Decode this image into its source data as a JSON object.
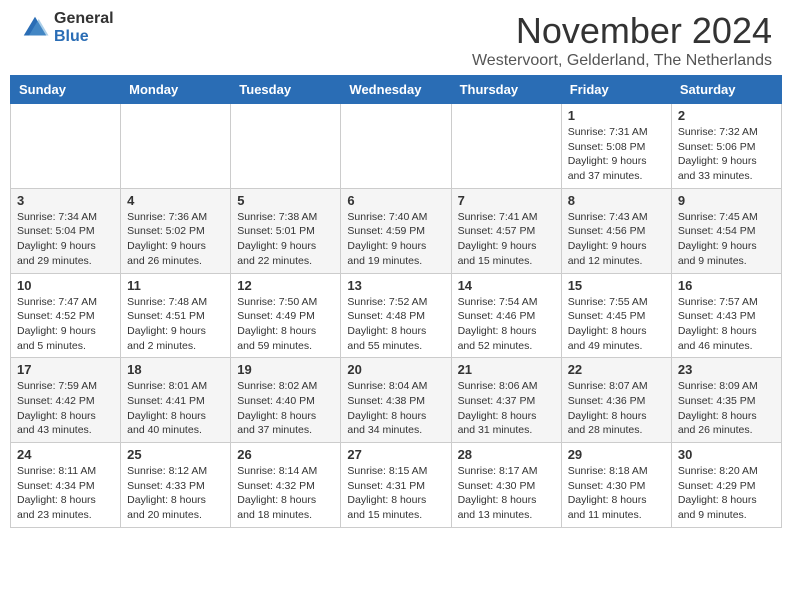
{
  "header": {
    "logo_general": "General",
    "logo_blue": "Blue",
    "month_title": "November 2024",
    "location": "Westervoort, Gelderland, The Netherlands"
  },
  "weekdays": [
    "Sunday",
    "Monday",
    "Tuesday",
    "Wednesday",
    "Thursday",
    "Friday",
    "Saturday"
  ],
  "weeks": [
    [
      {
        "day": "",
        "info": ""
      },
      {
        "day": "",
        "info": ""
      },
      {
        "day": "",
        "info": ""
      },
      {
        "day": "",
        "info": ""
      },
      {
        "day": "",
        "info": ""
      },
      {
        "day": "1",
        "info": "Sunrise: 7:31 AM\nSunset: 5:08 PM\nDaylight: 9 hours and 37 minutes."
      },
      {
        "day": "2",
        "info": "Sunrise: 7:32 AM\nSunset: 5:06 PM\nDaylight: 9 hours and 33 minutes."
      }
    ],
    [
      {
        "day": "3",
        "info": "Sunrise: 7:34 AM\nSunset: 5:04 PM\nDaylight: 9 hours and 29 minutes."
      },
      {
        "day": "4",
        "info": "Sunrise: 7:36 AM\nSunset: 5:02 PM\nDaylight: 9 hours and 26 minutes."
      },
      {
        "day": "5",
        "info": "Sunrise: 7:38 AM\nSunset: 5:01 PM\nDaylight: 9 hours and 22 minutes."
      },
      {
        "day": "6",
        "info": "Sunrise: 7:40 AM\nSunset: 4:59 PM\nDaylight: 9 hours and 19 minutes."
      },
      {
        "day": "7",
        "info": "Sunrise: 7:41 AM\nSunset: 4:57 PM\nDaylight: 9 hours and 15 minutes."
      },
      {
        "day": "8",
        "info": "Sunrise: 7:43 AM\nSunset: 4:56 PM\nDaylight: 9 hours and 12 minutes."
      },
      {
        "day": "9",
        "info": "Sunrise: 7:45 AM\nSunset: 4:54 PM\nDaylight: 9 hours and 9 minutes."
      }
    ],
    [
      {
        "day": "10",
        "info": "Sunrise: 7:47 AM\nSunset: 4:52 PM\nDaylight: 9 hours and 5 minutes."
      },
      {
        "day": "11",
        "info": "Sunrise: 7:48 AM\nSunset: 4:51 PM\nDaylight: 9 hours and 2 minutes."
      },
      {
        "day": "12",
        "info": "Sunrise: 7:50 AM\nSunset: 4:49 PM\nDaylight: 8 hours and 59 minutes."
      },
      {
        "day": "13",
        "info": "Sunrise: 7:52 AM\nSunset: 4:48 PM\nDaylight: 8 hours and 55 minutes."
      },
      {
        "day": "14",
        "info": "Sunrise: 7:54 AM\nSunset: 4:46 PM\nDaylight: 8 hours and 52 minutes."
      },
      {
        "day": "15",
        "info": "Sunrise: 7:55 AM\nSunset: 4:45 PM\nDaylight: 8 hours and 49 minutes."
      },
      {
        "day": "16",
        "info": "Sunrise: 7:57 AM\nSunset: 4:43 PM\nDaylight: 8 hours and 46 minutes."
      }
    ],
    [
      {
        "day": "17",
        "info": "Sunrise: 7:59 AM\nSunset: 4:42 PM\nDaylight: 8 hours and 43 minutes."
      },
      {
        "day": "18",
        "info": "Sunrise: 8:01 AM\nSunset: 4:41 PM\nDaylight: 8 hours and 40 minutes."
      },
      {
        "day": "19",
        "info": "Sunrise: 8:02 AM\nSunset: 4:40 PM\nDaylight: 8 hours and 37 minutes."
      },
      {
        "day": "20",
        "info": "Sunrise: 8:04 AM\nSunset: 4:38 PM\nDaylight: 8 hours and 34 minutes."
      },
      {
        "day": "21",
        "info": "Sunrise: 8:06 AM\nSunset: 4:37 PM\nDaylight: 8 hours and 31 minutes."
      },
      {
        "day": "22",
        "info": "Sunrise: 8:07 AM\nSunset: 4:36 PM\nDaylight: 8 hours and 28 minutes."
      },
      {
        "day": "23",
        "info": "Sunrise: 8:09 AM\nSunset: 4:35 PM\nDaylight: 8 hours and 26 minutes."
      }
    ],
    [
      {
        "day": "24",
        "info": "Sunrise: 8:11 AM\nSunset: 4:34 PM\nDaylight: 8 hours and 23 minutes."
      },
      {
        "day": "25",
        "info": "Sunrise: 8:12 AM\nSunset: 4:33 PM\nDaylight: 8 hours and 20 minutes."
      },
      {
        "day": "26",
        "info": "Sunrise: 8:14 AM\nSunset: 4:32 PM\nDaylight: 8 hours and 18 minutes."
      },
      {
        "day": "27",
        "info": "Sunrise: 8:15 AM\nSunset: 4:31 PM\nDaylight: 8 hours and 15 minutes."
      },
      {
        "day": "28",
        "info": "Sunrise: 8:17 AM\nSunset: 4:30 PM\nDaylight: 8 hours and 13 minutes."
      },
      {
        "day": "29",
        "info": "Sunrise: 8:18 AM\nSunset: 4:30 PM\nDaylight: 8 hours and 11 minutes."
      },
      {
        "day": "30",
        "info": "Sunrise: 8:20 AM\nSunset: 4:29 PM\nDaylight: 8 hours and 9 minutes."
      }
    ]
  ]
}
